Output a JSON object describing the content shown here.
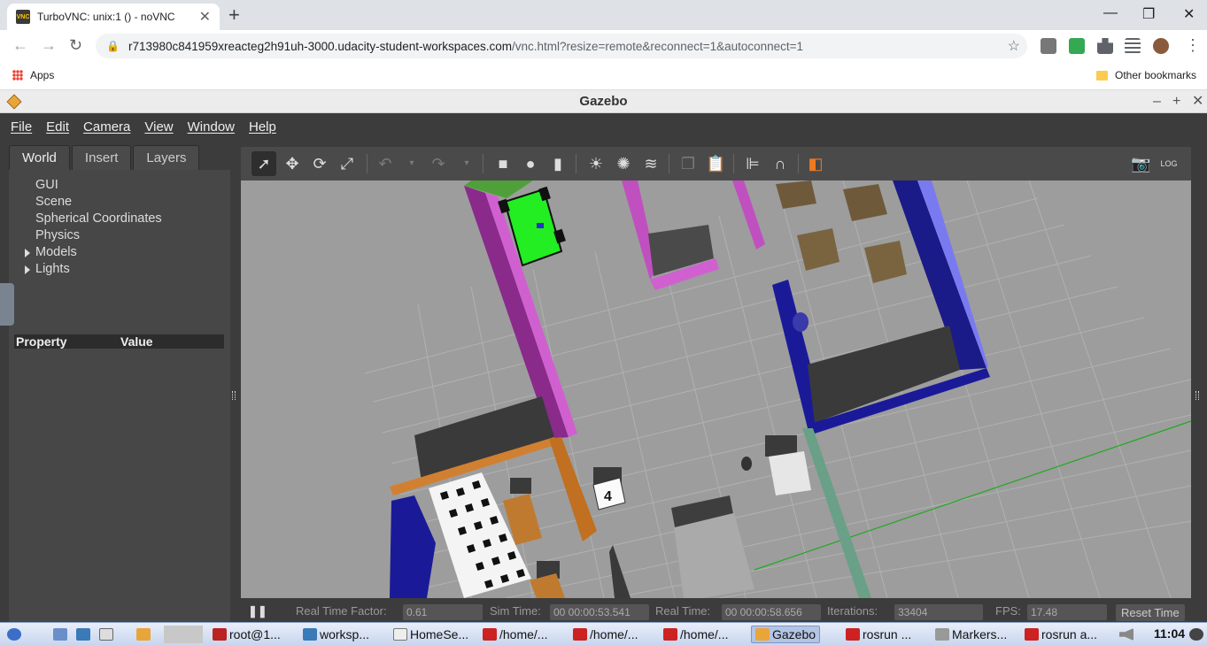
{
  "browser": {
    "tab_title": "TurboVNC: unix:1 () - noVNC",
    "favicon_text": "VNC",
    "url_host": "r713980c841959xreacteg2h91uh-3000.udacity-student-workspaces.com",
    "url_path": "/vnc.html?resize=remote&reconnect=1&autoconnect=1",
    "bookmarks": {
      "apps_label": "Apps",
      "other_label": "Other bookmarks"
    }
  },
  "gazebo": {
    "title": "Gazebo",
    "menu": [
      "File",
      "Edit",
      "Camera",
      "View",
      "Window",
      "Help"
    ],
    "left_tabs": [
      "World",
      "Insert",
      "Layers"
    ],
    "tree": [
      "GUI",
      "Scene",
      "Spherical Coordinates",
      "Physics",
      "Models",
      "Lights"
    ],
    "property_header": {
      "property": "Property",
      "value": "Value"
    },
    "status": {
      "pause_icon": "pause-icon",
      "real_time_factor_label": "Real Time Factor:",
      "real_time_factor": "0.61",
      "sim_time_label": "Sim Time:",
      "sim_time": "00 00:00:53.541",
      "real_time_label": "Real Time:",
      "real_time": "00 00:00:58.656",
      "iterations_label": "Iterations:",
      "iterations": "33404",
      "fps_label": "FPS:",
      "fps": "17.48",
      "reset_label": "Reset Time"
    },
    "scene": {
      "sign_number": "4",
      "grid_color": "#a6a6a6",
      "wall_magenta": "#d65ad6",
      "wall_blue": "#1a1a8c",
      "robot_green": "#22dd22"
    }
  },
  "taskbar": {
    "items": [
      "root@1...",
      "worksp...",
      "HomeSe...",
      "/home/...",
      "/home/...",
      "/home/...",
      "Gazebo",
      "rosrun ...",
      "Markers...",
      "rosrun a..."
    ],
    "clock": "11:04"
  }
}
